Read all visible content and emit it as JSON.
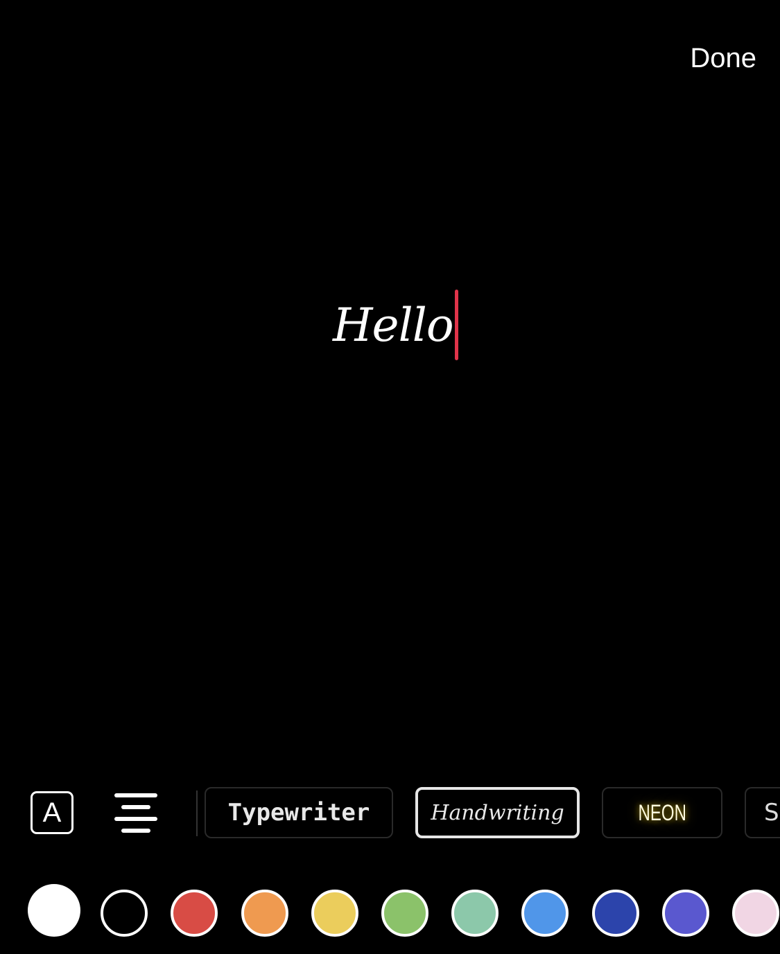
{
  "header": {
    "done_label": "Done"
  },
  "editor": {
    "text": "Hello",
    "caret_color": "#e0344a"
  },
  "toolbar": {
    "text_style_icon": "letter-a-boxed-icon",
    "align_icon": "align-center-icon",
    "styles": [
      {
        "label": "Typewriter",
        "selected": false
      },
      {
        "label": "Handwriting",
        "selected": true
      },
      {
        "label": "NEON",
        "selected": false
      },
      {
        "label": "S",
        "selected": false
      }
    ]
  },
  "colors": [
    {
      "name": "white",
      "hex": "#ffffff",
      "selected": true
    },
    {
      "name": "black",
      "hex": "#000000"
    },
    {
      "name": "red",
      "hex": "#d84c45"
    },
    {
      "name": "orange",
      "hex": "#ef9a50"
    },
    {
      "name": "yellow",
      "hex": "#ebcd5c"
    },
    {
      "name": "green",
      "hex": "#8bc26a"
    },
    {
      "name": "mint",
      "hex": "#8cc8aa"
    },
    {
      "name": "light-blue",
      "hex": "#5096e9"
    },
    {
      "name": "dark-blue",
      "hex": "#2c44ab"
    },
    {
      "name": "purple",
      "hex": "#5a58cf"
    },
    {
      "name": "pink",
      "hex": "#f1d6e4"
    }
  ]
}
